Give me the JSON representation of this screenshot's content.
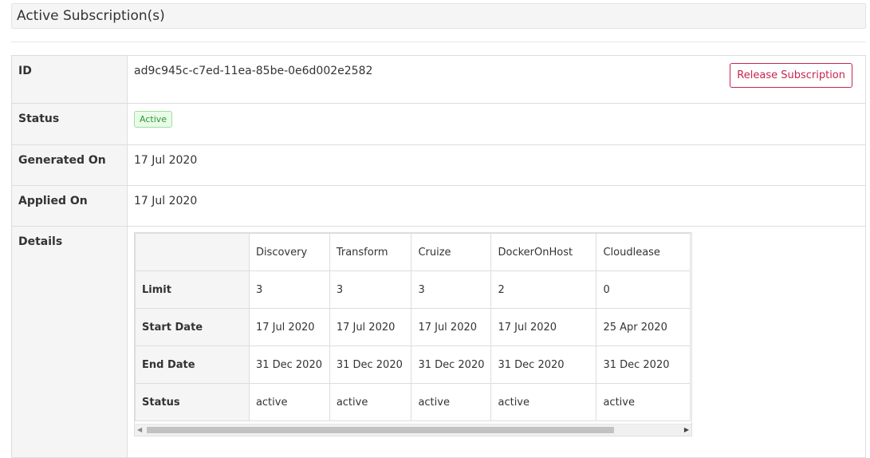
{
  "panel": {
    "title": "Active Subscription(s)"
  },
  "subscription": {
    "id_label": "ID",
    "id_value": "ad9c945c-c7ed-11ea-85be-0e6d002e2582",
    "release_button": "Release Subscription",
    "status_label": "Status",
    "status_value": "Active",
    "generated_label": "Generated On",
    "generated_value": "17 Jul 2020",
    "applied_label": "Applied On",
    "applied_value": "17 Jul 2020",
    "details_label": "Details"
  },
  "details": {
    "columns": [
      "Discovery",
      "Transform",
      "Cruize",
      "DockerOnHost",
      "Cloudlease"
    ],
    "rows": [
      {
        "label": "Limit",
        "cells": [
          "3",
          "3",
          "3",
          "2",
          "0"
        ]
      },
      {
        "label": "Start Date",
        "cells": [
          "17 Jul 2020",
          "17 Jul 2020",
          "17 Jul 2020",
          "17 Jul 2020",
          "25 Apr 2020"
        ]
      },
      {
        "label": "End Date",
        "cells": [
          "31 Dec 2020",
          "31 Dec 2020",
          "31 Dec 2020",
          "31 Dec 2020",
          "31 Dec 2020"
        ]
      },
      {
        "label": "Status",
        "cells": [
          "active",
          "active",
          "active",
          "active",
          "active"
        ]
      }
    ]
  },
  "colors": {
    "accent": "#c7254e",
    "status_green": "#2a9a2a"
  }
}
